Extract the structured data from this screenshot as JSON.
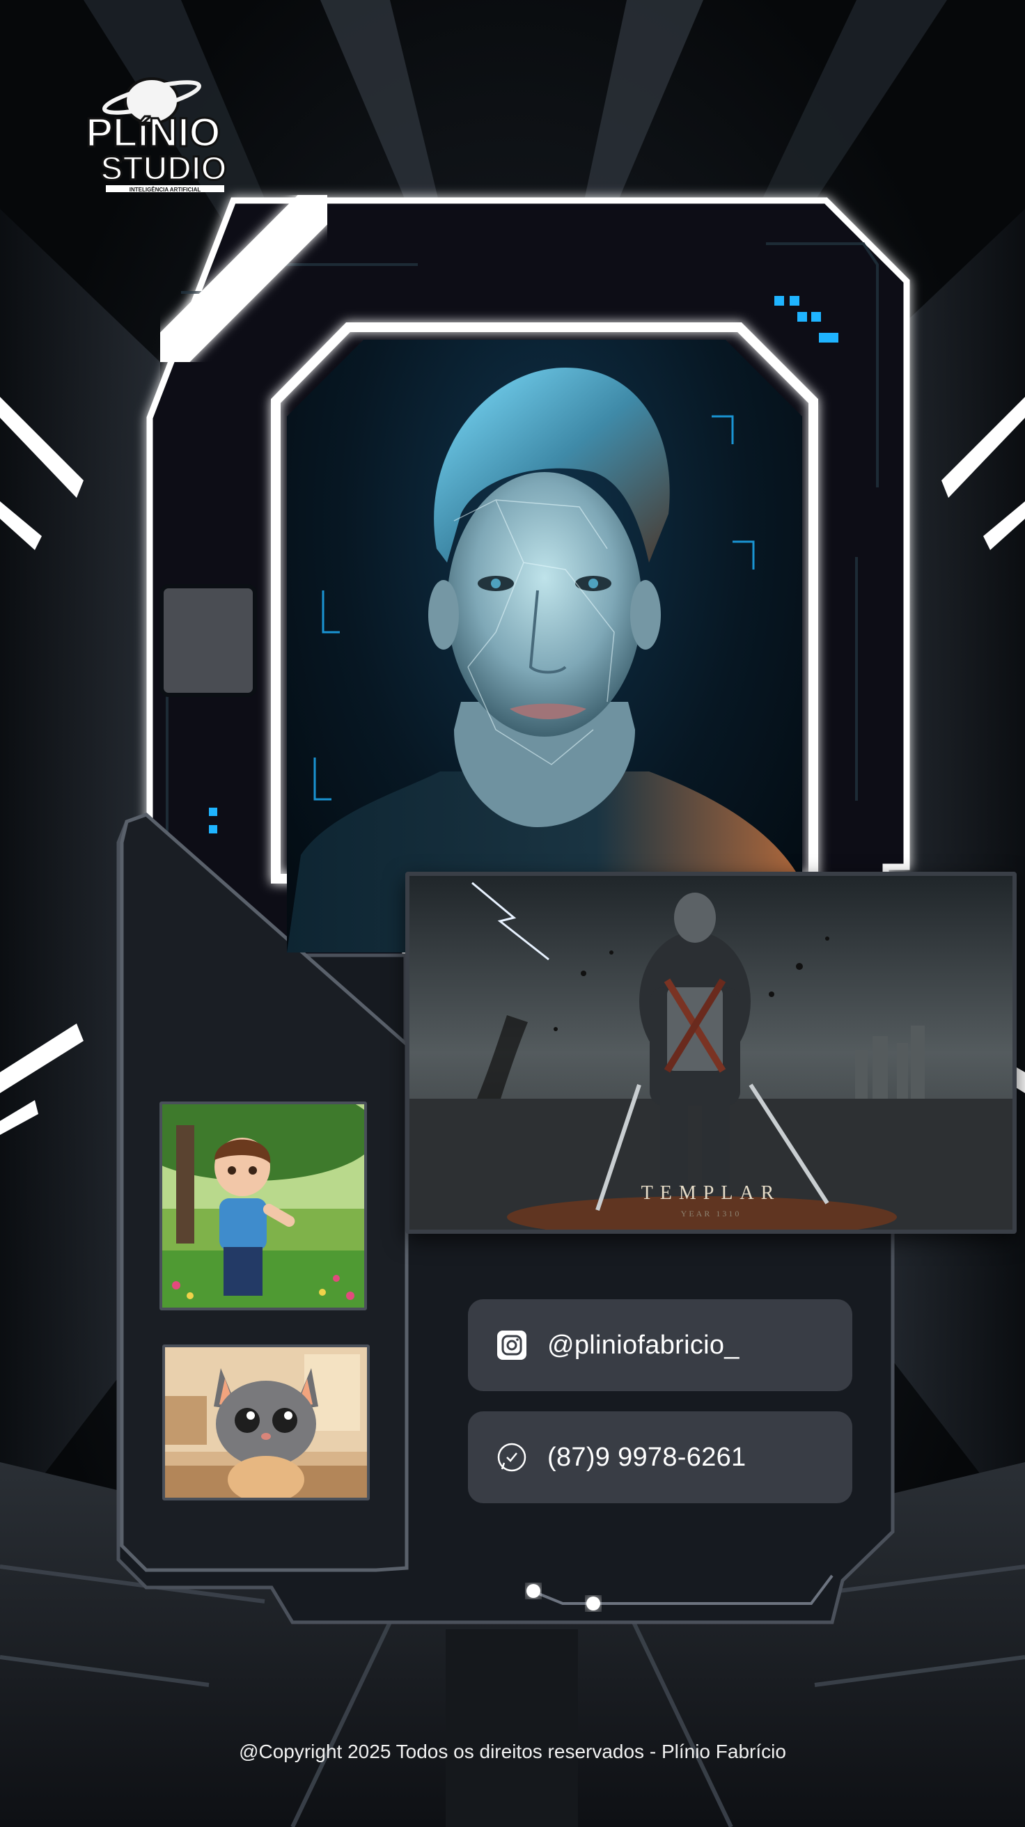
{
  "logo": {
    "line1": "PLíNIO",
    "line2": "STUDIO",
    "tagline": "INTELIGÊNCIA ARTIFICIAL"
  },
  "featured": {
    "title": "TEMPLAR",
    "subtitle": "YEAR 1310"
  },
  "contacts": {
    "instagram": {
      "icon": "instagram-icon",
      "label": "@pliniofabricio_"
    },
    "whatsapp": {
      "icon": "whatsapp-icon",
      "label": "(87)9 9978-6261"
    }
  },
  "footer": {
    "copyright": "@Copyright  2025 Todos os direitos reservados - Plínio Fabrício"
  },
  "colors": {
    "frame_glow": "#ffffff",
    "panel": "#1a1e24",
    "contact_bg": "#393d45",
    "accent_cyan": "#1fb4ff"
  }
}
